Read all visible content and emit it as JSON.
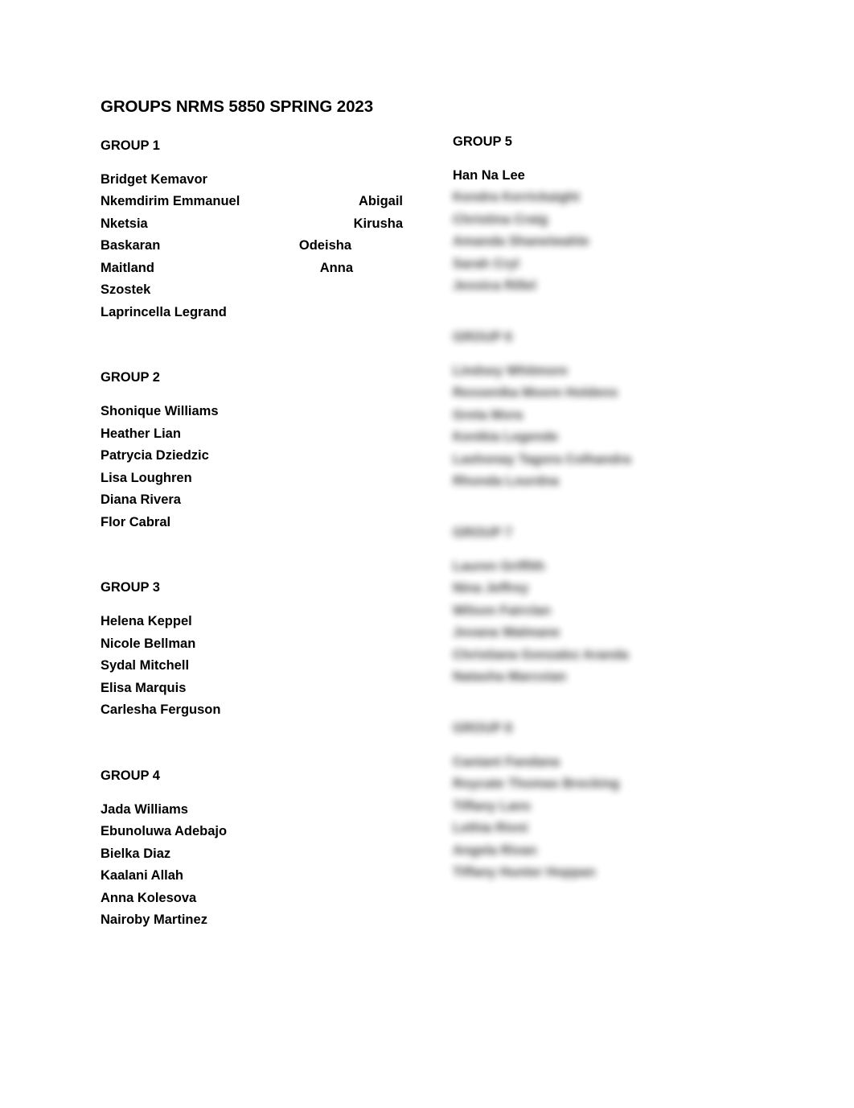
{
  "document": {
    "title": "GROUPS NRMS 5850 SPRING 2023",
    "background_color": "#ffffff",
    "text_color": "#000000"
  },
  "left_column": {
    "groups": [
      {
        "heading": "GROUP 1",
        "redacted": false,
        "members": [
          {
            "text": "Bridget Kemavor",
            "split": false
          },
          {
            "text": "Nkemdirim Emmanuel",
            "split": true,
            "left": "Nkemdirim Emmanuel",
            "right": "Abigail"
          },
          {
            "text": "Nketsia",
            "split": true,
            "left": "Nketsia",
            "right": "Kirusha"
          },
          {
            "text": "Baskaran",
            "split": true,
            "left": "Baskaran",
            "right": "Odeisha"
          },
          {
            "text": "Maitland",
            "split": true,
            "left": "Maitland",
            "right": "Anna"
          },
          {
            "text": "Szostek",
            "split": false
          },
          {
            "text": "Laprincella Legrand",
            "split": false
          }
        ]
      },
      {
        "heading": "GROUP 2",
        "redacted": false,
        "members": [
          {
            "text": "Shonique Williams",
            "split": false
          },
          {
            "text": "Heather Lian",
            "split": false
          },
          {
            "text": "Patrycia Dziedzic",
            "split": false
          },
          {
            "text": "Lisa Loughren",
            "split": false
          },
          {
            "text": "Diana Rivera",
            "split": false
          },
          {
            "text": "Flor Cabral",
            "split": false
          }
        ]
      },
      {
        "heading": "GROUP 3",
        "redacted": false,
        "members": [
          {
            "text": "Helena Keppel",
            "split": false
          },
          {
            "text": "Nicole Bellman",
            "split": false
          },
          {
            "text": "Sydal Mitchell",
            "split": false
          },
          {
            "text": "Elisa Marquis",
            "split": false
          },
          {
            "text": "Carlesha Ferguson",
            "split": false
          }
        ]
      },
      {
        "heading": "GROUP 4",
        "redacted": false,
        "members": [
          {
            "text": "Jada Williams",
            "split": false
          },
          {
            "text": "Ebunoluwa Adebajo",
            "split": false
          },
          {
            "text": "Bielka Diaz",
            "split": false
          },
          {
            "text": "Kaalani Allah",
            "split": false
          },
          {
            "text": "Anna Kolesova",
            "split": false
          },
          {
            "text": "Nairoby Martinez",
            "split": false
          }
        ]
      }
    ]
  },
  "right_column": {
    "groups": [
      {
        "heading": "GROUP 5",
        "heading_redacted": false,
        "members": [
          {
            "text": "Han Na Lee",
            "redacted": false
          },
          {
            "text": "Kendra Kerrickaight",
            "redacted": true
          },
          {
            "text": "Christina Craig",
            "redacted": true
          },
          {
            "text": "Amanda Shaneiwahle",
            "redacted": true
          },
          {
            "text": "Sarah Cryl",
            "redacted": true
          },
          {
            "text": "Jessica Rillel",
            "redacted": true
          }
        ]
      },
      {
        "heading": "GROUP 6",
        "heading_redacted": true,
        "members": [
          {
            "text": "Lindsey Whitmore",
            "redacted": true
          },
          {
            "text": "Ressenika Moore Holdens",
            "redacted": true
          },
          {
            "text": "Greta Mora",
            "redacted": true
          },
          {
            "text": "Kenikia Legende",
            "redacted": true
          },
          {
            "text": "Lashonay Tagora Colhandra",
            "redacted": true
          },
          {
            "text": "Rhonda Lourdna",
            "redacted": true
          }
        ]
      },
      {
        "heading": "GROUP 7",
        "heading_redacted": true,
        "members": [
          {
            "text": "Lauren Griffith",
            "redacted": true
          },
          {
            "text": "Nina Jeffrey",
            "redacted": true
          },
          {
            "text": "Wilson Fairclan",
            "redacted": true
          },
          {
            "text": "Jovana Walmane",
            "redacted": true
          },
          {
            "text": "Christiana Gonzalez Aranda",
            "redacted": true
          },
          {
            "text": "Natasha Marcoian",
            "redacted": true
          }
        ]
      },
      {
        "heading": "GROUP 8",
        "heading_redacted": true,
        "members": [
          {
            "text": "Caniant Fandana",
            "redacted": true
          },
          {
            "text": "Roycate Thomas Brecking",
            "redacted": true
          },
          {
            "text": "Tiffany Lans",
            "redacted": true
          },
          {
            "text": "Lethia Rivni",
            "redacted": true
          },
          {
            "text": "Angela Rivan",
            "redacted": true
          },
          {
            "text": "Tiffany Hunter Hoppan",
            "redacted": true
          }
        ]
      }
    ]
  }
}
